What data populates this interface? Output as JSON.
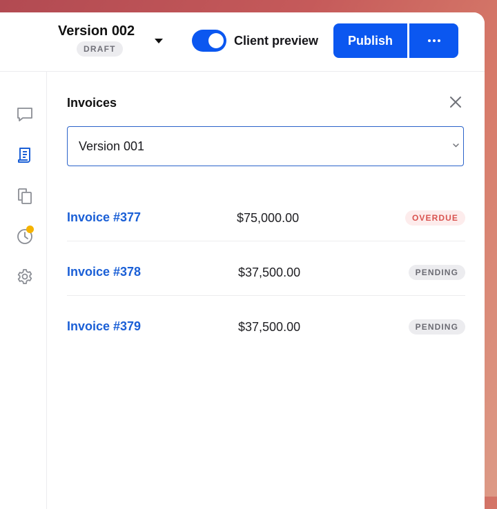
{
  "header": {
    "version_title": "Version 002",
    "version_status": "DRAFT",
    "client_preview_label": "Client preview",
    "client_preview_enabled": true,
    "publish_label": "Publish",
    "more_icon": "ellipsis-icon"
  },
  "sidebar": {
    "items": [
      {
        "icon": "comment-icon"
      },
      {
        "icon": "invoice-icon",
        "active": true
      },
      {
        "icon": "copy-icon"
      },
      {
        "icon": "clock-icon",
        "notification": true
      },
      {
        "icon": "gear-icon"
      }
    ]
  },
  "panel": {
    "title": "Invoices",
    "version_select": {
      "value": "Version 001"
    },
    "invoices": [
      {
        "name": "Invoice #377",
        "amount": "$75,000.00",
        "status": "OVERDUE"
      },
      {
        "name": "Invoice #378",
        "amount": "$37,500.00",
        "status": "PENDING"
      },
      {
        "name": "Invoice #379",
        "amount": "$37,500.00",
        "status": "PENDING"
      }
    ]
  },
  "colors": {
    "accent": "#0b57f0",
    "link": "#1a5fd6",
    "overdue": "#d9534f",
    "notification": "#f5b300"
  }
}
